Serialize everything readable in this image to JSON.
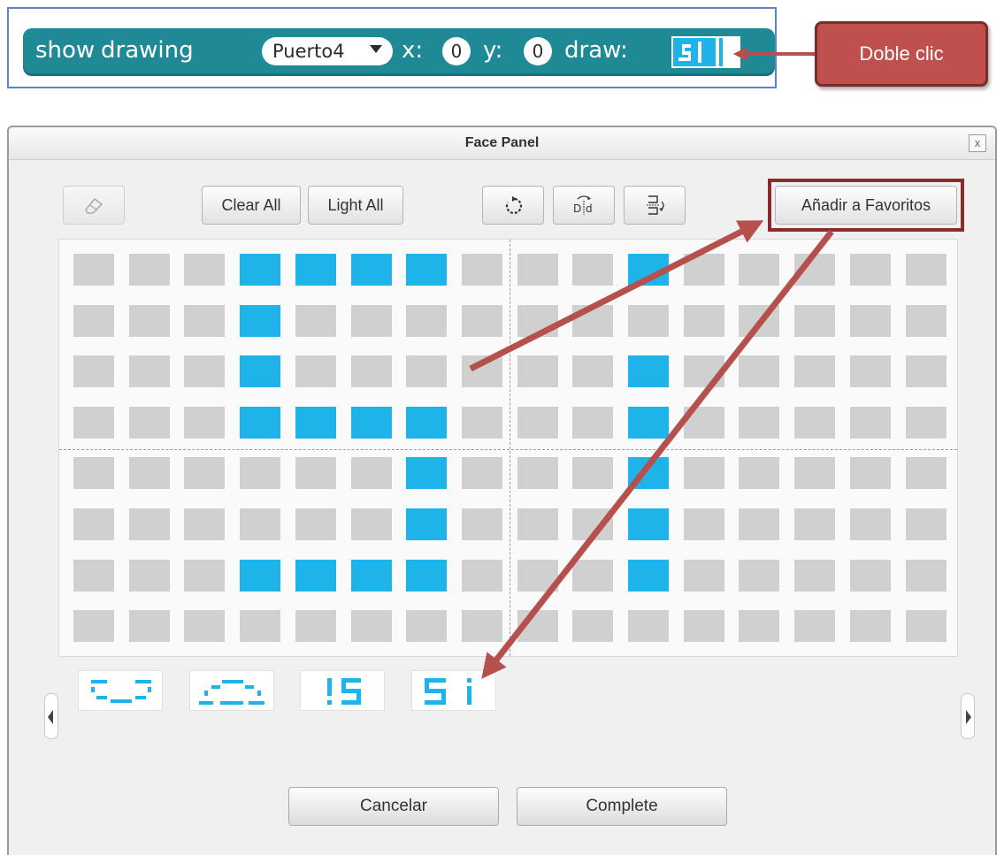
{
  "block": {
    "show_label": "show",
    "drawing_label": "drawing",
    "port_value": "Puerto4",
    "x_label": "x:",
    "x_value": "0",
    "y_label": "y:",
    "y_value": "0",
    "draw_label": "draw:"
  },
  "callout": {
    "text": "Doble clic"
  },
  "dialog": {
    "title": "Face Panel",
    "close_label": "x",
    "toolbar": {
      "eraser_icon": "eraser-icon",
      "clear_all": "Clear All",
      "light_all": "Light All",
      "rotate_icon": "rotate-icon",
      "flip_horizontal_icon": "flip-horizontal-icon",
      "flip_vertical_icon": "flip-vertical-icon",
      "add_favorite": "Añadir a Favoritos"
    },
    "matrix": {
      "rows": 8,
      "cols": 16,
      "on_color": "#1eb4ea",
      "off_color": "#d0d0d0",
      "lit": [
        [
          0,
          3
        ],
        [
          0,
          4
        ],
        [
          0,
          5
        ],
        [
          0,
          6
        ],
        [
          0,
          10
        ],
        [
          1,
          3
        ],
        [
          2,
          3
        ],
        [
          2,
          10
        ],
        [
          3,
          3
        ],
        [
          3,
          4
        ],
        [
          3,
          5
        ],
        [
          3,
          6
        ],
        [
          3,
          10
        ],
        [
          4,
          6
        ],
        [
          4,
          10
        ],
        [
          5,
          6
        ],
        [
          5,
          10
        ],
        [
          6,
          3
        ],
        [
          6,
          4
        ],
        [
          6,
          5
        ],
        [
          6,
          6
        ],
        [
          6,
          10
        ]
      ]
    },
    "favorites": [
      "smile-face",
      "frown-face",
      "!S",
      "Si"
    ],
    "prev_icon": "chevron-left-icon",
    "next_icon": "chevron-right-icon",
    "cancel": "Cancelar",
    "complete": "Complete"
  },
  "colors": {
    "block_teal": "#1f8a96",
    "led_blue": "#1eb4ea",
    "callout_red": "#c0504d",
    "annotation_arrow": "#b5504d"
  }
}
